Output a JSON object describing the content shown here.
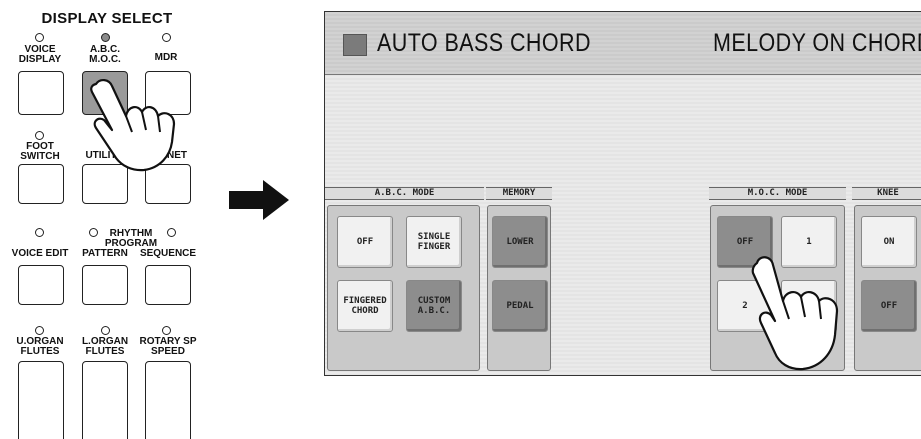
{
  "panel": {
    "title": "DISPLAY SELECT",
    "row1": [
      "VOICE\nDISPLAY",
      "A.B.C.\nM.O.C.",
      "MDR"
    ],
    "row2": [
      "FOOT\nSWITCH",
      "UTILITY",
      "CABINET"
    ],
    "row3": [
      "VOICE EDIT",
      "PATTERN",
      "SEQUENCE"
    ],
    "row3_header": "RHYTHM\nPROGRAM",
    "row4": [
      "U.ORGAN\nFLUTES",
      "L.ORGAN\nFLUTES",
      "ROTARY SP\nSPEED"
    ],
    "visible_row2": [
      "FOOT\nSWITCH",
      "UTILIT",
      "NET"
    ]
  },
  "screen": {
    "title_left": "AUTO BASS CHORD",
    "title_right": "MELODY ON CHORD",
    "abc_mode": {
      "label": "A.B.C. MODE",
      "buttons": [
        "OFF",
        "SINGLE\nFINGER",
        "FINGERED\nCHORD",
        "CUSTOM\nA.B.C."
      ]
    },
    "memory": {
      "label": "MEMORY",
      "buttons": [
        "LOWER",
        "PEDAL"
      ]
    },
    "moc_mode": {
      "label": "M.O.C. MODE",
      "buttons": [
        "OFF",
        "1",
        "2",
        ""
      ]
    },
    "knee": {
      "label": "KNEE",
      "buttons": [
        "ON",
        "OFF"
      ]
    }
  }
}
